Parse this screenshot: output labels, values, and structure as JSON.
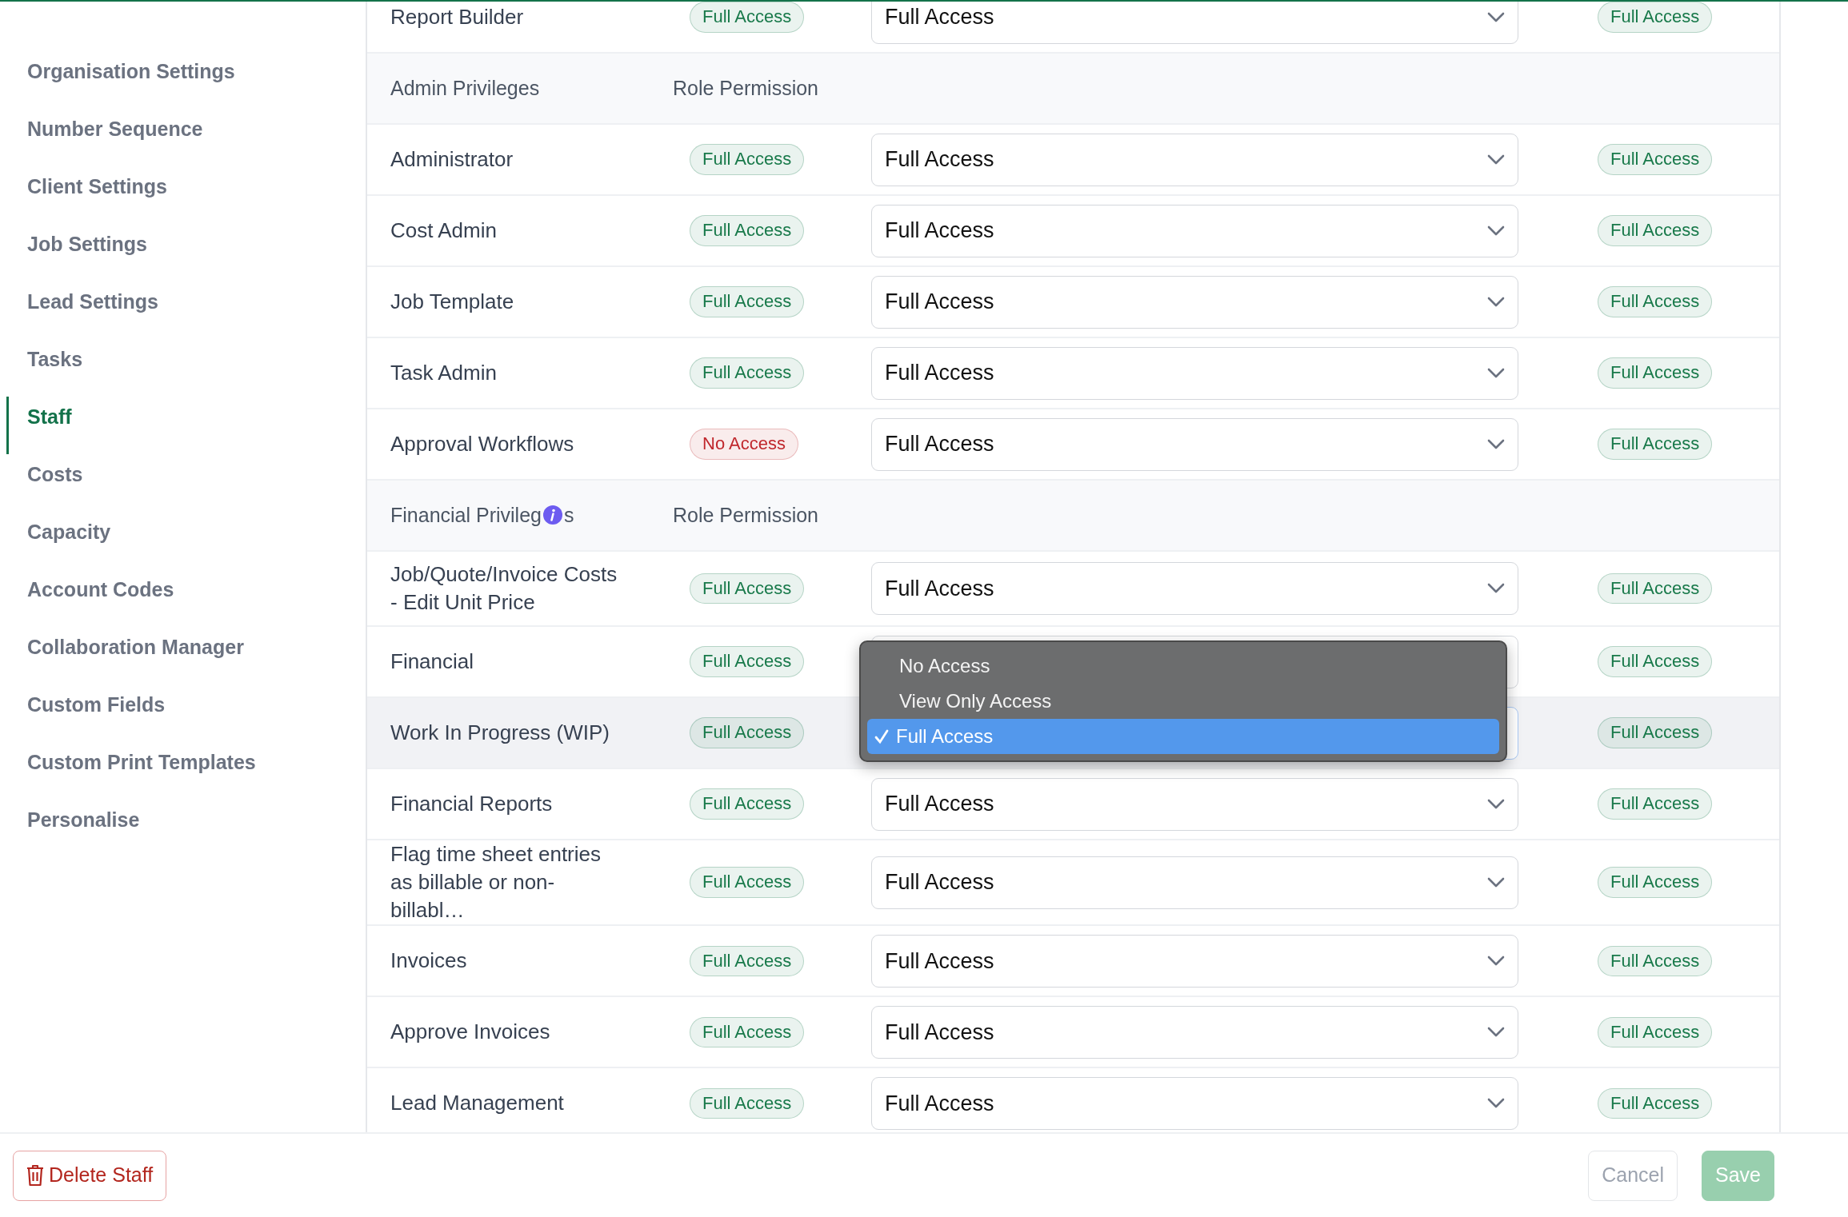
{
  "sidebar": {
    "items": [
      {
        "label": "Organisation Settings",
        "selected": false
      },
      {
        "label": "Number Sequence",
        "selected": false
      },
      {
        "label": "Client Settings",
        "selected": false
      },
      {
        "label": "Job Settings",
        "selected": false
      },
      {
        "label": "Lead Settings",
        "selected": false
      },
      {
        "label": "Tasks",
        "selected": false
      },
      {
        "label": "Staff",
        "selected": true
      },
      {
        "label": "Costs",
        "selected": false
      },
      {
        "label": "Capacity",
        "selected": false
      },
      {
        "label": "Account Codes",
        "selected": false
      },
      {
        "label": "Collaboration Manager",
        "selected": false
      },
      {
        "label": "Custom Fields",
        "selected": false
      },
      {
        "label": "Custom Print Templates",
        "selected": false
      },
      {
        "label": "Personalise",
        "selected": false
      }
    ]
  },
  "table": {
    "rows": [
      {
        "kind": "item",
        "name": "Report Builder",
        "role": {
          "text": "Full Access",
          "color": "#18794a"
        },
        "permission": "Full Access",
        "result": {
          "text": "Full Access",
          "color": "#18794a"
        },
        "hovered": false
      },
      {
        "kind": "header",
        "name": "Admin Privileges",
        "column": "Role Permission"
      },
      {
        "kind": "item",
        "name": "Administrator",
        "role": {
          "text": "Full Access",
          "color": "#18794a"
        },
        "permission": "Full Access",
        "result": {
          "text": "Full Access",
          "color": "#18794a"
        },
        "hovered": false
      },
      {
        "kind": "item",
        "name": "Cost Admin",
        "role": {
          "text": "Full Access",
          "color": "#18794a"
        },
        "permission": "Full Access",
        "result": {
          "text": "Full Access",
          "color": "#18794a"
        },
        "hovered": false
      },
      {
        "kind": "item",
        "name": "Job Template",
        "role": {
          "text": "Full Access",
          "color": "#18794a"
        },
        "permission": "Full Access",
        "result": {
          "text": "Full Access",
          "color": "#18794a"
        },
        "hovered": false
      },
      {
        "kind": "item",
        "name": "Task Admin",
        "role": {
          "text": "Full Access",
          "color": "#18794a"
        },
        "permission": "Full Access",
        "result": {
          "text": "Full Access",
          "color": "#18794a"
        },
        "hovered": false
      },
      {
        "kind": "item",
        "name": "Approval Workflows",
        "role": {
          "text": "No Access",
          "color": "#c0282d"
        },
        "permission": "Full Access",
        "result": {
          "text": "Full Access",
          "color": "#18794a"
        },
        "hovered": false
      },
      {
        "kind": "header",
        "name": "Financial Privileg",
        "name_tail": "s",
        "info": true,
        "column": "Role Permission"
      },
      {
        "kind": "item",
        "name": "Job/Quote/Invoice Costs - Edit Unit Price",
        "role": {
          "text": "Full Access",
          "color": "#18794a"
        },
        "permission": "Full Access",
        "result": {
          "text": "Full Access",
          "color": "#18794a"
        },
        "hovered": false
      },
      {
        "kind": "item",
        "name": "Financial",
        "role": {
          "text": "Full Access",
          "color": "#18794a"
        },
        "result": {
          "text": "Full Access",
          "color": "#18794a"
        },
        "hovered": false,
        "menu": [
          {
            "label": "No Access",
            "selected": false
          },
          {
            "label": "View Only Access",
            "selected": false
          },
          {
            "label": "Full Access",
            "selected": true
          }
        ]
      },
      {
        "kind": "item",
        "name": "Work In Progress (WIP)",
        "role": {
          "text": "Full Access",
          "color": "#18794a"
        },
        "result": {
          "text": "Full Access",
          "color": "#18794a"
        },
        "hovered": true
      },
      {
        "kind": "item",
        "name": "Financial Reports",
        "role": {
          "text": "Full Access",
          "color": "#18794a"
        },
        "permission": "Full Access",
        "result": {
          "text": "Full Access",
          "color": "#18794a"
        },
        "hovered": false
      },
      {
        "kind": "item",
        "name": "Flag time sheet entries as billable or non-billabl…",
        "role": {
          "text": "Full Access",
          "color": "#18794a"
        },
        "permission": "Full Access",
        "result": {
          "text": "Full Access",
          "color": "#18794a"
        },
        "hovered": false
      },
      {
        "kind": "item",
        "name": "Invoices",
        "role": {
          "text": "Full Access",
          "color": "#18794a"
        },
        "permission": "Full Access",
        "result": {
          "text": "Full Access",
          "color": "#18794a"
        },
        "hovered": false
      },
      {
        "kind": "item",
        "name": "Approve Invoices",
        "role": {
          "text": "Full Access",
          "color": "#18794a"
        },
        "permission": "Full Access",
        "result": {
          "text": "Full Access",
          "color": "#18794a"
        },
        "hovered": false
      },
      {
        "kind": "item",
        "name": "Lead Management",
        "role": {
          "text": "Full Access",
          "color": "#18794a"
        },
        "permission": "Full Access",
        "result": {
          "text": "Full Access",
          "color": "#18794a"
        },
        "hovered": false
      }
    ]
  },
  "footer": {
    "buttons": [
      {
        "label": "Delete Staff",
        "kind": "danger"
      },
      {
        "label": "Cancel",
        "kind": "secondary"
      },
      {
        "label": "Save",
        "kind": "primary",
        "disabled": true
      }
    ]
  }
}
